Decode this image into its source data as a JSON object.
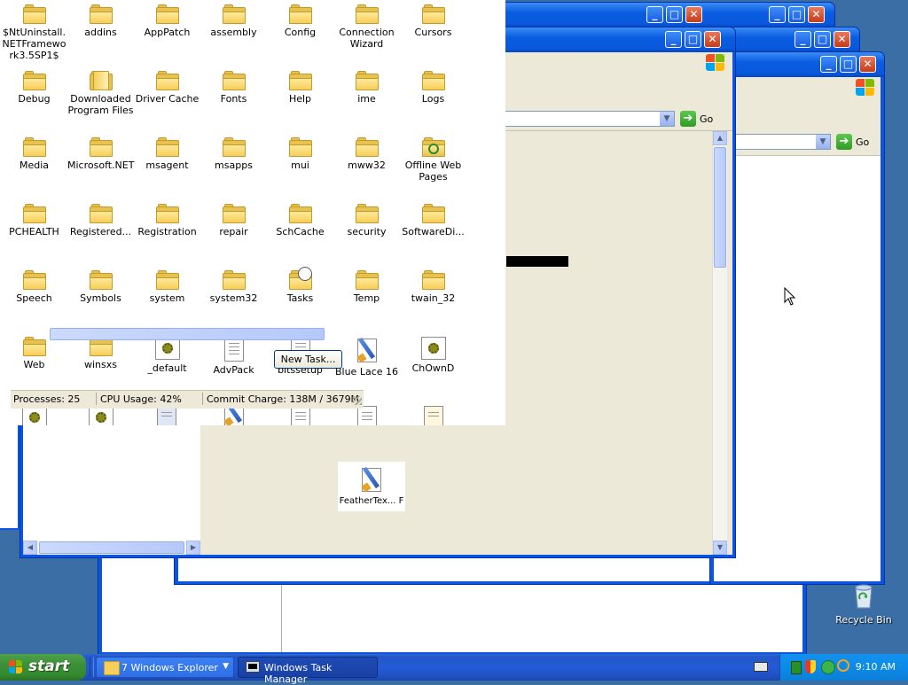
{
  "explorer_main": {
    "folders": [
      {
        "label": "$NtUninstall.NETFramework3.5SP1$"
      },
      {
        "label": "addins"
      },
      {
        "label": "AppPatch"
      },
      {
        "label": "assembly"
      },
      {
        "label": "Config"
      },
      {
        "label": "Connection Wizard"
      },
      {
        "label": "Cursors"
      },
      {
        "label": "Debug"
      },
      {
        "label": "Downloaded Program Files"
      },
      {
        "label": "Driver Cache"
      },
      {
        "label": "Fonts"
      },
      {
        "label": "Help"
      },
      {
        "label": "ime"
      },
      {
        "label": "Logs"
      },
      {
        "label": "Media"
      },
      {
        "label": "Microsoft.NET"
      },
      {
        "label": "msagent"
      },
      {
        "label": "msapps"
      },
      {
        "label": "mui"
      },
      {
        "label": "mww32"
      },
      {
        "label": "Offline Web Pages"
      },
      {
        "label": "PCHEALTH"
      },
      {
        "label": "Registered..."
      },
      {
        "label": "Registration"
      },
      {
        "label": "repair"
      },
      {
        "label": "SchCache"
      },
      {
        "label": "security"
      },
      {
        "label": "SoftwareDi..."
      },
      {
        "label": "Speech"
      },
      {
        "label": "Symbols"
      },
      {
        "label": "system"
      },
      {
        "label": "system32"
      },
      {
        "label": "Tasks"
      },
      {
        "label": "Temp"
      },
      {
        "label": "twain_32"
      },
      {
        "label": "Web"
      },
      {
        "label": "winsxs"
      },
      {
        "label": "_default"
      },
      {
        "label": "AdvPack"
      },
      {
        "label": "bitssetup"
      },
      {
        "label": "Blue Lace 16"
      },
      {
        "label": "ChOwnD"
      }
    ],
    "feather_file": "FeatherTex... F"
  },
  "task_manager": {
    "new_task_button": "New Task...",
    "status": {
      "processes": "Processes: 25",
      "cpu": "CPU Usage: 42%",
      "commit": "Commit Charge: 138M / 3679M"
    }
  },
  "explorer_windows": {
    "go_label": "Go"
  },
  "desktop": {
    "recycle_bin": "Recycle Bin"
  },
  "taskbar": {
    "start_label": "start",
    "group_button": "7 Windows Explorer",
    "task_manager_button": "Windows Task Manager",
    "clock": "9:10 AM"
  },
  "colors": {
    "xp_title_blue": "#0a5de0",
    "close_red": "#c83a17",
    "taskbar_blue": "#245ad6",
    "start_green": "#3c8f38",
    "tray_blue": "#0c8ae8",
    "folder_yellow": "#f6cf5a"
  }
}
